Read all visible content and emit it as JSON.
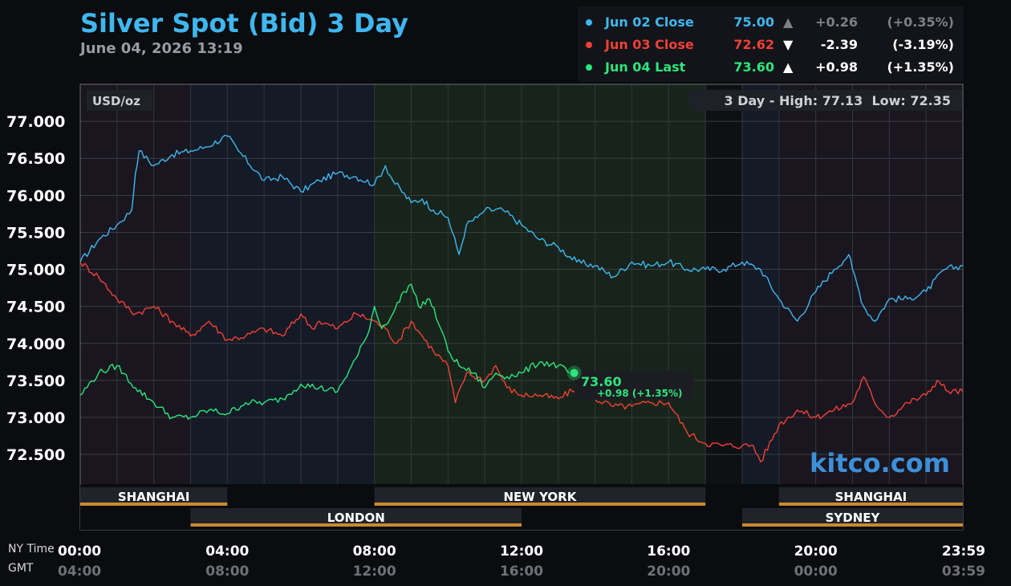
{
  "header": {
    "title": "Silver Spot (Bid) 3 Day",
    "datetime": "June 04, 2026 13:19"
  },
  "legend": [
    {
      "name": "Jun 02 Close",
      "value": "75.00",
      "arrow": "▲",
      "change": "+0.26",
      "pct": "(+0.35%)",
      "color": "#3fb7ef",
      "muted": true
    },
    {
      "name": "Jun 03 Close",
      "value": "72.62",
      "arrow": "▼",
      "change": "-2.39",
      "pct": "(-3.19%)",
      "color": "#ef4136",
      "muted": false
    },
    {
      "name": "Jun 04 Last",
      "value": "73.60",
      "arrow": "▲",
      "change": "+0.98",
      "pct": "(+1.35%)",
      "color": "#2ee57d",
      "muted": false
    }
  ],
  "chart_labels": {
    "unit": "USD/oz",
    "high_low": "3 Day - High: 77.13  Low: 72.35",
    "last_value": "73.60",
    "last_change": "+0.98 (+1.35%)",
    "watermark": "kitco.com",
    "ny_time_label": "NY Time",
    "gmt_label": "GMT"
  },
  "sessions": {
    "row1": [
      {
        "name": "SHANGHAI",
        "start": 0,
        "end": 4
      },
      {
        "name": "NEW YORK",
        "start": 8,
        "end": 17
      },
      {
        "name": "SHANGHAI",
        "start": 19,
        "end": 24
      }
    ],
    "row2": [
      {
        "name": "LONDON",
        "start": 3,
        "end": 12
      },
      {
        "name": "SYDNEY",
        "start": 18,
        "end": 24
      }
    ]
  },
  "chart_data": {
    "type": "line",
    "title": "Silver Spot (Bid) 3 Day",
    "ylabel": "USD/oz",
    "ylim": [
      72.1,
      77.5
    ],
    "xlim": [
      0,
      24
    ],
    "y_ticks": [
      "77.000",
      "76.500",
      "76.000",
      "75.500",
      "75.000",
      "74.500",
      "74.000",
      "73.500",
      "73.000",
      "72.500"
    ],
    "y_tick_values": [
      77.0,
      76.5,
      76.0,
      75.5,
      75.0,
      74.5,
      74.0,
      73.5,
      73.0,
      72.5
    ],
    "x_ticks": [
      {
        "t": 0,
        "ny": "00:00",
        "gmt": "04:00"
      },
      {
        "t": 4,
        "ny": "04:00",
        "gmt": "08:00"
      },
      {
        "t": 8,
        "ny": "08:00",
        "gmt": "12:00"
      },
      {
        "t": 12,
        "ny": "12:00",
        "gmt": "16:00"
      },
      {
        "t": 16,
        "ny": "16:00",
        "gmt": "20:00"
      },
      {
        "t": 20,
        "ny": "20:00",
        "gmt": "00:00"
      },
      {
        "t": 23.98,
        "ny": "23:59",
        "gmt": "03:59"
      }
    ],
    "grid": true,
    "series": [
      {
        "name": "Jun 02 Close",
        "color": "#3fb7ef",
        "x": [
          0,
          0.5,
          1,
          1.4,
          1.5,
          1.6,
          2,
          2.5,
          3,
          3.4,
          4,
          4.3,
          5,
          5.5,
          6,
          6.5,
          7,
          7.5,
          8,
          8.3,
          8.5,
          9,
          9.3,
          9.6,
          10,
          10.3,
          10.5,
          10.8,
          11,
          11.5,
          12,
          12.5,
          13,
          13.5,
          14,
          14.5,
          15,
          15.5,
          16,
          16.5,
          17,
          17.5,
          18,
          18.5,
          19,
          19.5,
          20,
          20.5,
          20.9,
          21,
          21.3,
          21.6,
          22,
          22.5,
          23,
          23.5,
          24
        ],
        "values": [
          75.1,
          75.4,
          75.6,
          75.8,
          76.3,
          76.6,
          76.4,
          76.55,
          76.6,
          76.65,
          76.8,
          76.6,
          76.2,
          76.25,
          76.05,
          76.2,
          76.3,
          76.25,
          76.15,
          76.4,
          76.2,
          75.9,
          75.95,
          75.8,
          75.7,
          75.2,
          75.6,
          75.7,
          75.8,
          75.8,
          75.6,
          75.4,
          75.3,
          75.1,
          75.05,
          74.9,
          75.1,
          75.05,
          75.1,
          75.0,
          75.0,
          75.0,
          75.1,
          75.0,
          74.6,
          74.3,
          74.7,
          75.0,
          75.2,
          75.0,
          74.5,
          74.3,
          74.6,
          74.6,
          74.7,
          75.0,
          75.05
        ]
      },
      {
        "name": "Jun 03 Close",
        "color": "#ef4136",
        "x": [
          0,
          0.5,
          1,
          1.5,
          2,
          2.5,
          3,
          3.5,
          4,
          4.5,
          5,
          5.5,
          6,
          6.3,
          6.5,
          7,
          7.5,
          8,
          8.3,
          8.6,
          9,
          9.3,
          9.6,
          10,
          10.2,
          10.5,
          11,
          11.3,
          11.6,
          12,
          12.5,
          13,
          13.5,
          14,
          14.5,
          15,
          15.5,
          16,
          16.5,
          17,
          17.5,
          18,
          18.3,
          18.5,
          19,
          19.5,
          20,
          20.5,
          21,
          21.3,
          21.6,
          22,
          22.5,
          23,
          23.3,
          23.6,
          24
        ],
        "values": [
          75.1,
          74.9,
          74.6,
          74.4,
          74.5,
          74.3,
          74.1,
          74.3,
          74.05,
          74.1,
          74.2,
          74.1,
          74.4,
          74.2,
          74.3,
          74.2,
          74.4,
          74.3,
          74.2,
          74.0,
          74.3,
          74.1,
          73.9,
          73.7,
          73.2,
          73.6,
          73.5,
          73.7,
          73.4,
          73.3,
          73.3,
          73.25,
          73.4,
          73.25,
          73.15,
          73.15,
          73.2,
          73.2,
          72.8,
          72.65,
          72.62,
          72.62,
          72.62,
          72.4,
          72.9,
          73.1,
          73.0,
          73.1,
          73.2,
          73.55,
          73.2,
          73.0,
          73.2,
          73.3,
          73.5,
          73.35,
          73.35
        ]
      },
      {
        "name": "Jun 04 Last",
        "color": "#2ee57d",
        "x": [
          0,
          0.5,
          1,
          1.5,
          2,
          2.5,
          3,
          3.5,
          4,
          4.5,
          5,
          5.5,
          6,
          6.5,
          7,
          7.5,
          7.8,
          8,
          8.2,
          8.5,
          8.8,
          9,
          9.2,
          9.5,
          9.8,
          10,
          10.3,
          10.7,
          11,
          11.3,
          11.6,
          12,
          12.5,
          13,
          13.3
        ],
        "values": [
          73.3,
          73.6,
          73.7,
          73.4,
          73.2,
          73.0,
          73.0,
          73.1,
          73.05,
          73.2,
          73.2,
          73.25,
          73.45,
          73.4,
          73.35,
          73.8,
          74.1,
          74.5,
          74.2,
          74.4,
          74.7,
          74.8,
          74.5,
          74.6,
          74.2,
          73.9,
          73.7,
          73.6,
          73.4,
          73.6,
          73.55,
          73.6,
          73.75,
          73.7,
          73.6
        ]
      }
    ]
  }
}
